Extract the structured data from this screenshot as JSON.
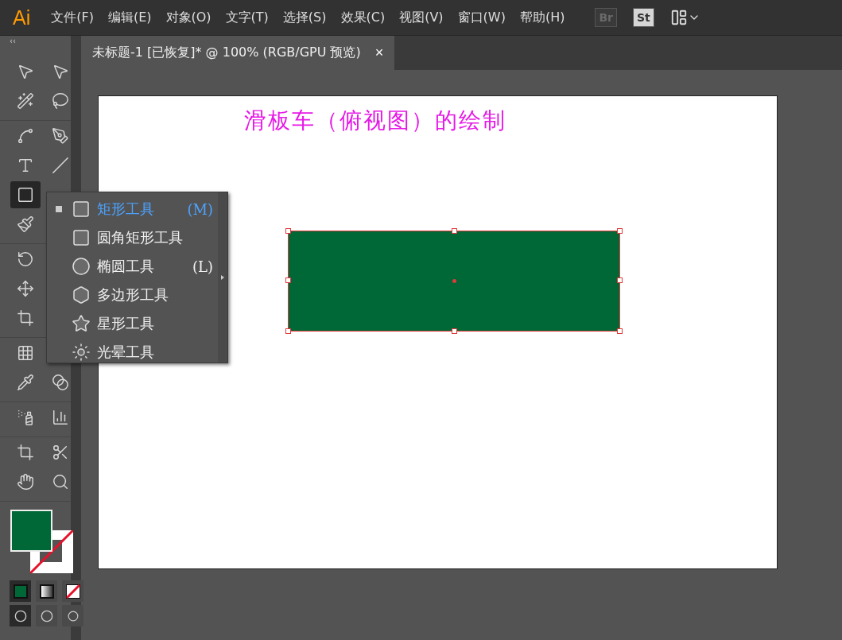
{
  "app": {
    "logo": "Ai",
    "menu": [
      "文件(F)",
      "编辑(E)",
      "对象(O)",
      "文字(T)",
      "选择(S)",
      "效果(C)",
      "视图(V)",
      "窗口(W)",
      "帮助(H)"
    ],
    "bridge": "Br",
    "stock": "St"
  },
  "toolbar": {
    "collapse": "‹‹",
    "groups": [
      [
        [
          {
            "kind": "select",
            "selected": false
          },
          {
            "kind": "direct",
            "selected": false
          }
        ],
        [
          {
            "kind": "wand",
            "selected": false
          },
          {
            "kind": "lasso",
            "selected": false
          }
        ]
      ],
      [
        [
          {
            "kind": "curvature",
            "selected": false
          },
          {
            "kind": "pen",
            "selected": false
          }
        ],
        [
          {
            "kind": "type",
            "selected": false
          },
          {
            "kind": "line",
            "selected": false
          }
        ],
        [
          {
            "kind": "rect",
            "selected": true
          }
        ],
        [
          {
            "kind": "shaper",
            "selected": false
          }
        ]
      ],
      [
        [
          {
            "kind": "rotate",
            "selected": false
          }
        ],
        [
          {
            "kind": "puppet",
            "selected": false
          }
        ],
        [
          {
            "kind": "transform",
            "selected": false
          }
        ]
      ],
      [
        [
          {
            "kind": "mesh",
            "selected": false
          }
        ],
        [
          {
            "kind": "eyedropper",
            "selected": false
          },
          {
            "kind": "blend",
            "selected": false
          }
        ]
      ],
      [
        [
          {
            "kind": "sprayer",
            "selected": false
          },
          {
            "kind": "graph",
            "selected": false
          }
        ]
      ],
      [
        [
          {
            "kind": "artboard",
            "selected": false
          },
          {
            "kind": "slice",
            "selected": false
          }
        ],
        [
          {
            "kind": "hand",
            "selected": false
          },
          {
            "kind": "zoom",
            "selected": false
          }
        ]
      ]
    ]
  },
  "flyout": [
    {
      "label": "矩形工具",
      "shortcut": "(M)",
      "kind": "rect",
      "selected": true
    },
    {
      "label": "圆角矩形工具",
      "kind": "rounded",
      "selected": false
    },
    {
      "label": "椭圆工具",
      "shortcut": "(L)",
      "kind": "ellipse",
      "selected": false
    },
    {
      "label": "多边形工具",
      "kind": "polygon",
      "selected": false
    },
    {
      "label": "星形工具",
      "kind": "star",
      "selected": false
    },
    {
      "label": "光晕工具",
      "kind": "flare",
      "selected": false
    }
  ],
  "document": {
    "tab": "未标题-1 [已恢复]* @ 100% (RGB/GPU 预览)",
    "close": "×",
    "heading": "滑板车（俯视图）的绘制"
  }
}
